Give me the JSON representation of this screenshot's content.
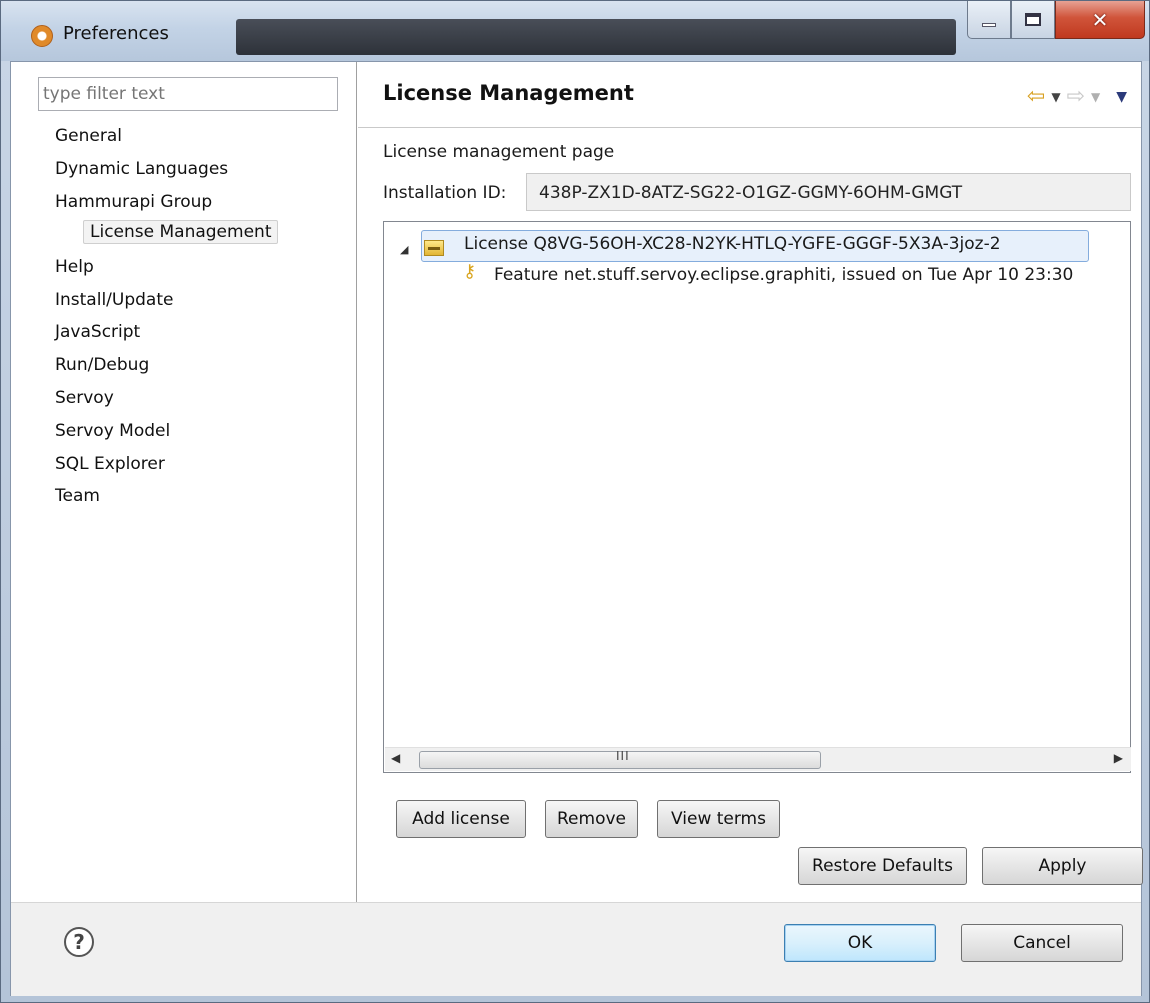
{
  "window": {
    "title": "Preferences"
  },
  "sidebar": {
    "filter_placeholder": "type filter text",
    "items": [
      {
        "label": "General"
      },
      {
        "label": "Dynamic Languages"
      },
      {
        "label": "Hammurapi Group"
      },
      {
        "label": "License Management",
        "selected": true
      },
      {
        "label": "Help"
      },
      {
        "label": "Install/Update"
      },
      {
        "label": "JavaScript"
      },
      {
        "label": "Run/Debug"
      },
      {
        "label": "Servoy"
      },
      {
        "label": "Servoy Model"
      },
      {
        "label": "SQL Explorer"
      },
      {
        "label": "Team"
      }
    ]
  },
  "page": {
    "title": "License Management",
    "description": "License management page",
    "installation_label": "Installation ID:",
    "installation_id": "438P-ZX1D-8ATZ-SG22-O1GZ-GGMY-6OHM-GMGT",
    "licenses": [
      {
        "label": "License Q8VG-56OH-XC28-N2YK-HTLQ-YGFE-GGGF-5X3A-3joz-2",
        "features": [
          {
            "label": "Feature net.stuff.servoy.eclipse.graphiti, issued on Tue Apr 10 23:30"
          }
        ]
      }
    ],
    "scroll_grip": "III",
    "buttons": {
      "add_license": "Add license",
      "remove": "Remove",
      "view_terms": "View terms",
      "restore_defaults": "Restore Defaults",
      "apply": "Apply"
    }
  },
  "footer": {
    "ok": "OK",
    "cancel": "Cancel"
  },
  "icons": {
    "app": "preferences-icon",
    "back": "back-arrow-icon",
    "forward": "forward-arrow-icon",
    "menu": "view-menu-icon",
    "license": "license-icon",
    "feature": "key-icon",
    "help": "help-icon"
  }
}
